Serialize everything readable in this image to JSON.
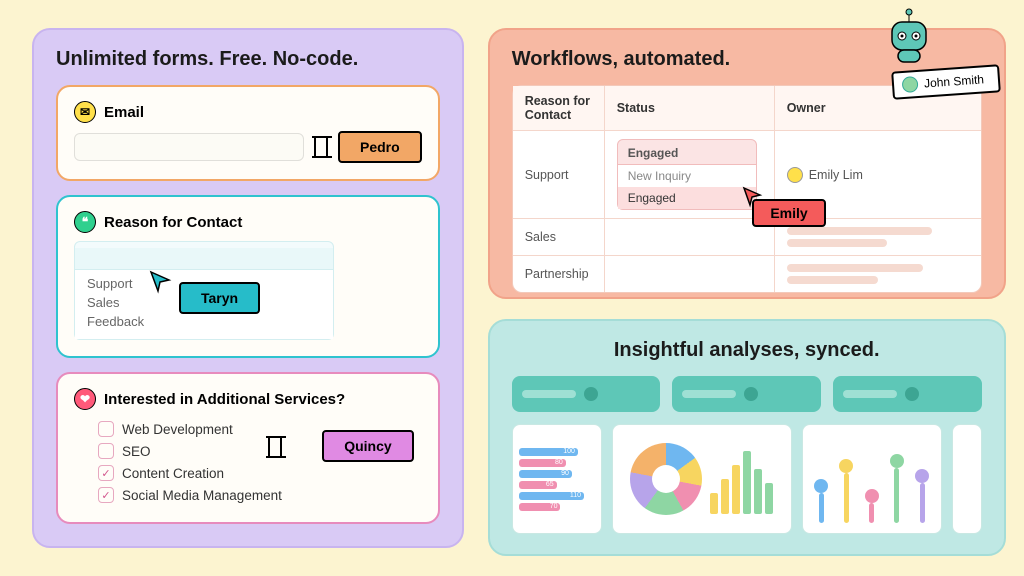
{
  "forms": {
    "title": "Unlimited forms. Free. No-code.",
    "email": {
      "label": "Email",
      "tag": "Pedro"
    },
    "reason": {
      "label": "Reason for Contact",
      "options": [
        "Support",
        "Sales",
        "Feedback"
      ],
      "tag": "Taryn"
    },
    "services": {
      "label": "Interested in Additional Services?",
      "items": [
        {
          "label": "Web Development",
          "checked": false
        },
        {
          "label": "SEO",
          "checked": false
        },
        {
          "label": "Content Creation",
          "checked": true
        },
        {
          "label": "Social Media Management",
          "checked": true
        }
      ],
      "tag": "Quincy"
    }
  },
  "workflows": {
    "title": "Workflows, automated.",
    "columns": [
      "Reason for Contact",
      "Status",
      "Owner"
    ],
    "rows": [
      {
        "reason": "Support",
        "status": "Engaged",
        "owner": "Emily Lim"
      },
      {
        "reason": "Sales"
      },
      {
        "reason": "Partnership"
      }
    ],
    "status_options": [
      "New Inquiry",
      "Engaged"
    ],
    "tag": "Emily",
    "floating_card": "John Smith"
  },
  "analyses": {
    "title": "Insightful analyses, synced.",
    "bar_values": [
      100,
      80,
      90,
      65,
      110,
      70
    ]
  },
  "colors": {
    "blue": "#6fb7f0",
    "yellow": "#f7d560",
    "pink": "#f08fb0",
    "green": "#8ed6a3",
    "purple": "#b7a4ea",
    "orange": "#f4b26a"
  },
  "chart_data": [
    {
      "type": "bar",
      "orientation": "horizontal",
      "values": [
        100,
        80,
        90,
        65,
        110,
        70
      ],
      "title": "",
      "xlabel": "",
      "ylabel": ""
    },
    {
      "type": "pie",
      "series": [
        {
          "name": "blue",
          "value": 15
        },
        {
          "name": "yellow",
          "value": 13
        },
        {
          "name": "pink",
          "value": 14
        },
        {
          "name": "green",
          "value": 18
        },
        {
          "name": "purple",
          "value": 18
        },
        {
          "name": "orange",
          "value": 22
        }
      ]
    }
  ]
}
